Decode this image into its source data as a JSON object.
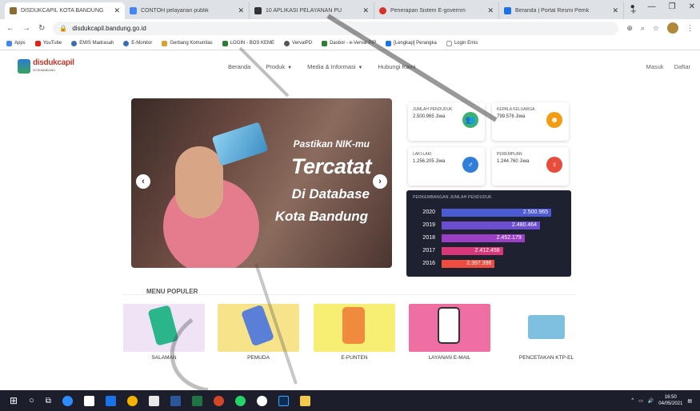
{
  "tabs": [
    {
      "title": "DISDUKCAPIL KOTA BANDUNG",
      "color": "#8b6b2f",
      "active": true
    },
    {
      "title": "CONTOH pelayanan publik",
      "color": "#4285f4",
      "active": false
    },
    {
      "title": "10 APLIKASI PELAYANAN PU",
      "color": "#333333",
      "active": false
    },
    {
      "title": "Penerapan Sistem E-governm",
      "color": "#d93025",
      "active": false
    },
    {
      "title": "Beranda | Portal Resmi Pemk",
      "color": "#1a73e8",
      "active": false
    }
  ],
  "new_tab_glyph": "+",
  "address": {
    "url": "disdukcapil.bandung.go.id"
  },
  "bookmarks": [
    "Apps",
    "YouTube",
    "EMIS Madrasah",
    "E-Monitor",
    "Gerbang Komunitas",
    "LOGIN - BOS KEME",
    "VervalPD",
    "Dasbor - e-Verval PIP",
    "[Lengkap] Perangka",
    "Login Emis"
  ],
  "site": {
    "logo_text": "disdukcapil",
    "logo_sub": "KOTA BANDUNG",
    "nav": [
      {
        "label": "Beranda",
        "dropdown": false
      },
      {
        "label": "Produk",
        "dropdown": true
      },
      {
        "label": "Media & Informasi",
        "dropdown": true
      },
      {
        "label": "Hubungi Kami",
        "dropdown": false
      }
    ],
    "login": "Masuk",
    "register": "Daftar"
  },
  "hero": {
    "line1": "Pastikan NIK-mu",
    "line2": "Tercatat",
    "line3": "Di Database",
    "line4": "Kota Bandung",
    "prev": "‹",
    "next": "›"
  },
  "stats": [
    {
      "label": "JUMLAH PENDUDUK",
      "value": "2.500.965 Jiwa",
      "icon": "people-icon",
      "color": "#3bb273"
    },
    {
      "label": "KEPALA KELUARGA",
      "value": "799.576 Jiwa",
      "icon": "family-icon",
      "color": "#f39c12"
    },
    {
      "label": "LAKI-LAKI",
      "value": "1.256.205 Jiwa",
      "icon": "male-icon",
      "color": "#2f7ed8"
    },
    {
      "label": "PEREMPUAN",
      "value": "1.244.760 Jiwa",
      "icon": "female-icon",
      "color": "#e74c3c"
    }
  ],
  "chart_data": {
    "type": "bar",
    "title": "PERKEMBANGAN JUMLAH PENDUDUK",
    "categories": [
      "2020",
      "2019",
      "2018",
      "2017",
      "2016"
    ],
    "values": [
      2500965,
      2480464,
      2452179,
      2412458,
      2397396
    ],
    "labels": [
      "2.500.965",
      "2.480.464",
      "2.452.179",
      "2.412.458",
      "2.397.396"
    ],
    "colors": [
      "#4c5bd4",
      "#6c4fd0",
      "#9b3fc4",
      "#d8387a",
      "#ef4b3f"
    ],
    "xlim": [
      2300000,
      2520000
    ]
  },
  "menu": {
    "title": "MENU POPULER",
    "items": [
      {
        "label": "SALAMAN",
        "bg": "#efe3f6",
        "accent": "#2bb58a"
      },
      {
        "label": "PEMUDA",
        "bg": "#f7e48a",
        "accent": "#5a7fd6"
      },
      {
        "label": "E-PUNTEN",
        "bg": "#f6ef73",
        "accent": "#f08a3c"
      },
      {
        "label": "LAYANAN E-MAIL",
        "bg": "#f06fa3",
        "accent": "#ffffff"
      },
      {
        "label": "PENCETAKAN KTP-EL",
        "bg": "#ffffff",
        "accent": "#7fbfe0"
      }
    ]
  },
  "taskbar": {
    "time": "16:50",
    "date": "04/05/2021"
  }
}
